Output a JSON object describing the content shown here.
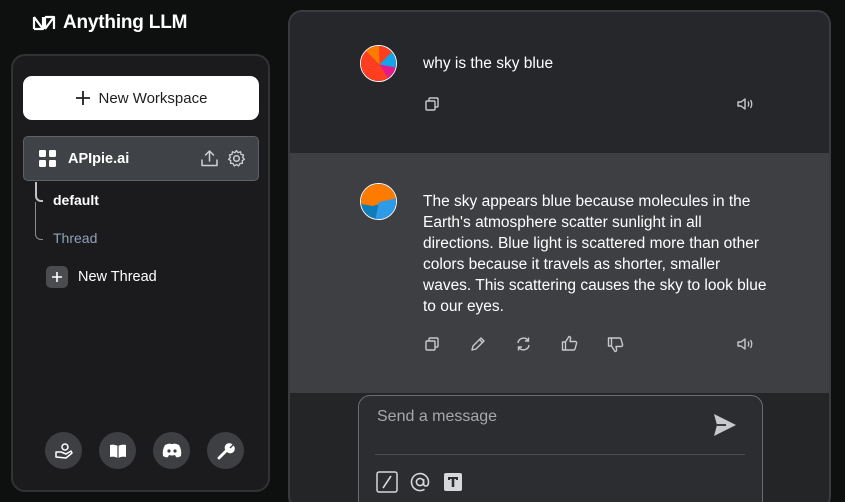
{
  "app": {
    "title": "Anything LLM",
    "logo_icon": "anythingllm-logo-icon"
  },
  "sidebar": {
    "new_workspace_label": "New Workspace",
    "workspace": {
      "name": "APIpie.ai",
      "icons": [
        "upload-icon",
        "gear-icon"
      ]
    },
    "threads": [
      {
        "label": "default",
        "active": true
      },
      {
        "label": "Thread",
        "active": false
      }
    ],
    "new_thread_label": "New Thread",
    "footer_icons": [
      "community-hub-icon",
      "docs-book-icon",
      "discord-icon",
      "settings-wrench-icon"
    ]
  },
  "chat": {
    "messages": [
      {
        "role": "user",
        "text": "why is the sky blue",
        "actions": [
          "copy-icon",
          "speaker-icon"
        ]
      },
      {
        "role": "assistant",
        "text": "The sky appears blue because molecules in the Earth's atmosphere scatter sunlight in all directions. Blue light is scattered more than other colors because it travels as shorter, smaller waves. This scattering causes the sky to look blue to our eyes.",
        "actions": [
          "copy-icon",
          "edit-pencil-icon",
          "regenerate-icon",
          "thumbs-up-icon",
          "thumbs-down-icon",
          "speaker-icon"
        ]
      }
    ],
    "input": {
      "placeholder": "Send a message",
      "value": "",
      "send_icon": "send-icon",
      "tools": [
        "slash-command-icon",
        "at-mention-icon",
        "text-size-icon"
      ]
    }
  },
  "colors": {
    "background": "#0e0f0f",
    "sidebar": "#1b1b1e",
    "assistant_message_bg": "#3d3f43",
    "user_message_bg": "#26272a",
    "thread_muted": "#8fa2b9"
  }
}
